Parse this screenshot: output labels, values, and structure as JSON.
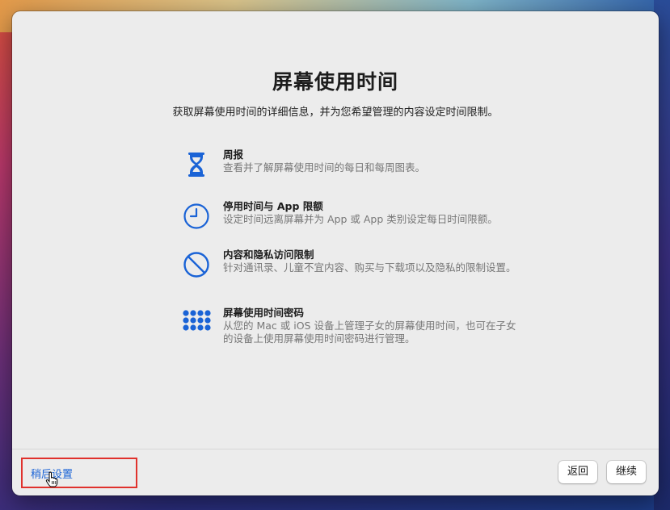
{
  "window": {
    "title": "屏幕使用时间",
    "subtitle": "获取屏幕使用时间的详细信息，并为您希望管理的内容设定时间限制。"
  },
  "features": [
    {
      "icon": "hourglass-icon",
      "title": "周报",
      "description": "查看并了解屏幕使用时间的每日和每周图表。"
    },
    {
      "icon": "clock-icon",
      "title": "停用时间与 App 限额",
      "description": "设定时间远离屏幕并为 App 或 App 类别设定每日时间限额。"
    },
    {
      "icon": "restriction-icon",
      "title": "内容和隐私访问限制",
      "description": "针对通讯录、儿童不宜内容、购买与下载项以及隐私的限制设置。"
    },
    {
      "icon": "passcode-keypad-icon",
      "title": "屏幕使用时间密码",
      "description": "从您的 Mac 或 iOS 设备上管理子女的屏幕使用时间，也可在子女的设备上使用屏幕使用时间密码进行管理。"
    }
  ],
  "footer": {
    "later_label": "稍后设置",
    "back_label": "返回",
    "continue_label": "继续"
  },
  "colors": {
    "accent": "#1a63d6",
    "highlight": "#e0322d"
  }
}
